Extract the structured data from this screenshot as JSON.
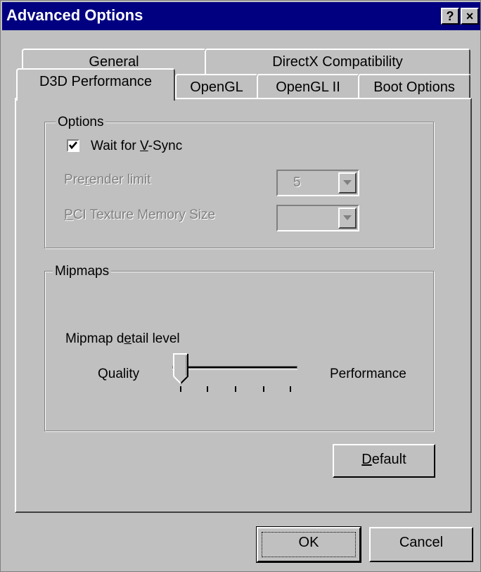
{
  "window": {
    "title": "Advanced Options",
    "help_button": "?",
    "close_button": "×"
  },
  "tabs": {
    "row1": [
      {
        "label": "General"
      },
      {
        "label": "DirectX Compatibility"
      }
    ],
    "row2": [
      {
        "label": "D3D Performance",
        "selected": true
      },
      {
        "label": "OpenGL"
      },
      {
        "label": "OpenGL II"
      },
      {
        "label": "Boot Options"
      }
    ]
  },
  "options_group": {
    "legend": "Options",
    "wait_vsync": {
      "label_pre": "Wait for ",
      "label_ul": "V",
      "label_post": "-Sync",
      "checked": true
    },
    "prerender": {
      "label_pre": "Pre",
      "label_ul": "r",
      "label_post": "ender limit",
      "value": "5",
      "enabled": false
    },
    "pci_texture": {
      "label_ul": "P",
      "label_post": "CI Texture Memory Size",
      "value": "",
      "enabled": false
    }
  },
  "mipmaps_group": {
    "legend": "Mipmaps",
    "detail_label_pre": "Mipmap d",
    "detail_label_ul": "e",
    "detail_label_post": "tail level",
    "left_label": "Quality",
    "right_label": "Performance",
    "slider_position": 0,
    "slider_ticks": 5
  },
  "buttons": {
    "default_ul": "D",
    "default_post": "efault",
    "ok": "OK",
    "cancel": "Cancel"
  },
  "colors": {
    "title_bar": "#000080",
    "face": "#c0c0c0",
    "disabled_text": "#808080"
  }
}
